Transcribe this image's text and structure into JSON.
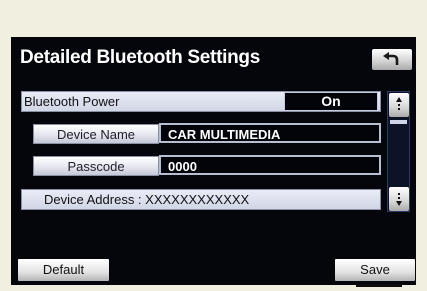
{
  "screen": {
    "title": "Detailed Bluetooth Settings",
    "back_icon": "back-arrow-icon"
  },
  "bluetooth_power": {
    "label": "Bluetooth Power",
    "value": "On"
  },
  "device_name": {
    "label": "Device Name",
    "value": "CAR MULTIMEDIA"
  },
  "passcode": {
    "label": "Passcode",
    "value": "0000"
  },
  "device_address": {
    "text": "Device Address : XXXXXXXXXXXX"
  },
  "buttons": {
    "default_label": "Default",
    "save_label": "Save"
  },
  "scrollbar": {
    "up_icon": "scroll-up-icon",
    "down_icon": "scroll-down-icon"
  }
}
